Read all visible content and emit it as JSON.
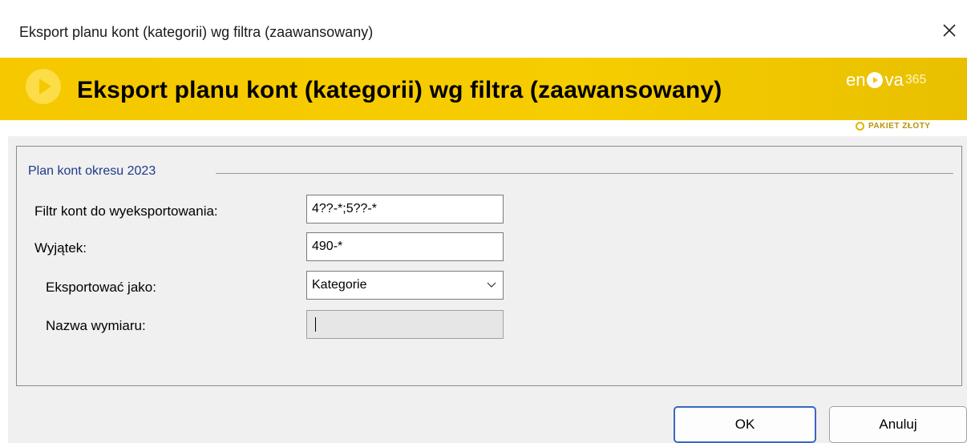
{
  "window": {
    "title": "Eksport planu kont (kategorii) wg filtra (zaawansowany)",
    "close_glyph": "✕"
  },
  "banner": {
    "heading": "Eksport planu kont (kategorii) wg filtra (zaawansowany)",
    "logo_prefix": "en",
    "logo_suffix": "va",
    "logo_number": "365",
    "package": "PAKIET ZŁOTY",
    "accent_color": "#f5c800"
  },
  "form": {
    "group_title": "Plan kont okresu 2023",
    "filter_label": "Filtr kont do wyeksportowania:",
    "filter_value": "4??-*;5??-*",
    "exception_label": "Wyjątek:",
    "exception_value": "490-*",
    "export_as_label": "Eksportować jako:",
    "export_as_value": "Kategorie",
    "dimension_label": "Nazwa wymiaru:",
    "dimension_value": ""
  },
  "buttons": {
    "ok": "OK",
    "cancel": "Anuluj"
  }
}
